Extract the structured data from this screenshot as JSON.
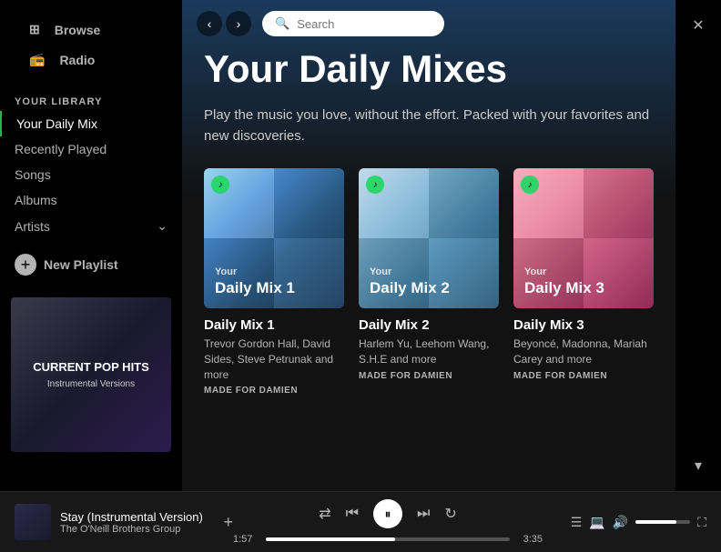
{
  "sidebar": {
    "nav": [
      {
        "id": "browse",
        "label": "Browse",
        "icon": "grid"
      },
      {
        "id": "radio",
        "label": "Radio",
        "icon": "radio"
      }
    ],
    "library_label": "YOUR LIBRARY",
    "library_items": [
      {
        "id": "daily-mix",
        "label": "Your Daily Mix",
        "active": true
      },
      {
        "id": "recently-played",
        "label": "Recently Played",
        "active": false
      },
      {
        "id": "songs",
        "label": "Songs",
        "active": false
      },
      {
        "id": "albums",
        "label": "Albums",
        "active": false
      },
      {
        "id": "artists",
        "label": "Artists",
        "active": false
      }
    ],
    "new_playlist_label": "New Playlist",
    "album_art": {
      "line1": "CURRENT POP HITS",
      "line2": "Instrumental Versions"
    }
  },
  "topbar": {
    "search_placeholder": "Search"
  },
  "main": {
    "page_title": "Your Daily Mixes",
    "page_subtitle": "Play the music you love, without the effort. Packed with your favorites and new discoveries.",
    "mixes": [
      {
        "id": "mix1",
        "label_your": "Your",
        "label_name": "Daily Mix 1",
        "title": "Daily Mix 1",
        "artists": "Trevor Gordon Hall, David Sides, Steve Petrunak and more",
        "made_for": "MADE FOR DAMIEN",
        "gradient_class": "mix1-bg"
      },
      {
        "id": "mix2",
        "label_your": "Your",
        "label_name": "Daily Mix 2",
        "title": "Daily Mix 2",
        "artists": "Harlem Yu, Leehom Wang, S.H.E and more",
        "made_for": "MADE FOR DAMIEN",
        "gradient_class": "mix2-bg"
      },
      {
        "id": "mix3",
        "label_your": "Your",
        "label_name": "Daily Mix 3",
        "title": "Daily Mix 3",
        "artists": "Beyoncé, Madonna, Mariah Carey and more",
        "made_for": "MADE FOR DAMIEN",
        "gradient_class": "mix3-bg"
      }
    ]
  },
  "playback": {
    "track_name": "Stay (Instrumental Version)",
    "track_artist": "The O'Neill Brothers Group",
    "time_current": "1:57",
    "time_total": "3:35",
    "progress_pct": 53
  }
}
